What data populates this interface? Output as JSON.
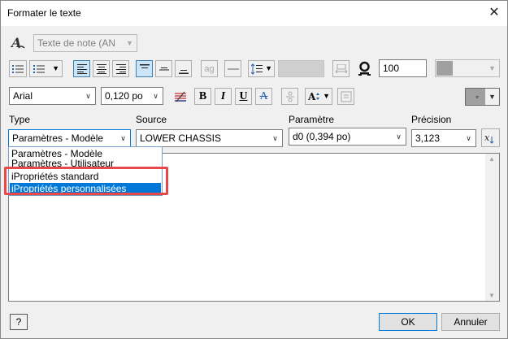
{
  "window": {
    "title": "Formater le texte"
  },
  "toolbar1": {
    "style_value": "Texte de note (AN"
  },
  "toolbar2": {
    "line_spacing_value": "100"
  },
  "toolbar3": {
    "font": "Arial",
    "size": "0,120 po",
    "bold": "B",
    "italic": "I",
    "underline": "U",
    "strike": "A",
    "color_value": "◦"
  },
  "type": {
    "label": "Type",
    "value": "Paramètres - Modèle"
  },
  "source": {
    "label": "Source",
    "value": "LOWER CHASSIS"
  },
  "parameter": {
    "label": "Paramètre",
    "value": "d0 (0,394 po)"
  },
  "precision": {
    "label": "Précision",
    "value": "3,123"
  },
  "dropdown": {
    "options": [
      {
        "label": "Paramètres - Modèle"
      },
      {
        "label": "Paramètres - Utilisateur"
      },
      {
        "label": "iPropriétés standard"
      },
      {
        "label": "iPropriétés personnalisées"
      }
    ],
    "highlighted_index": 3
  },
  "footer": {
    "help_label": "?",
    "ok_label": "OK",
    "cancel_label": "Annuler"
  },
  "colors": {
    "highlight": "#0078d7",
    "annotation": "#e84848",
    "selected_button": "#cce4f7"
  }
}
